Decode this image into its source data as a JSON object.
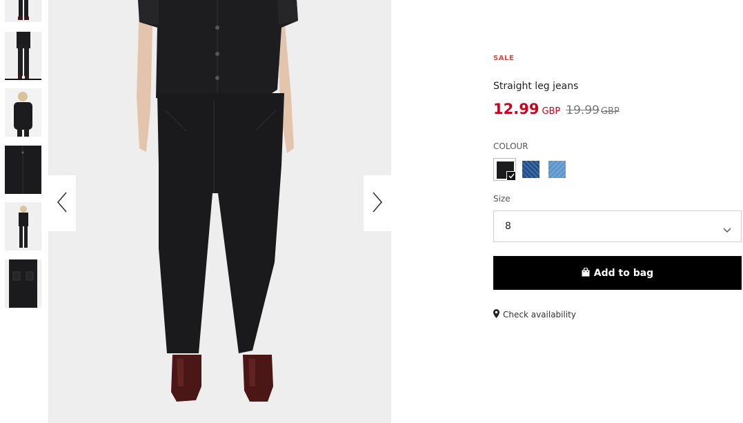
{
  "gallery": {
    "thumbnails": [
      {
        "name": "thumb-1",
        "alt": "full look legs"
      },
      {
        "name": "thumb-2",
        "alt": "full look front",
        "active": true
      },
      {
        "name": "thumb-3",
        "alt": "upper body"
      },
      {
        "name": "thumb-4",
        "alt": "jeans detail"
      },
      {
        "name": "thumb-5",
        "alt": "full look side"
      },
      {
        "name": "thumb-6",
        "alt": "back detail"
      }
    ],
    "prev_icon": "chevron-left-icon",
    "next_icon": "chevron-right-icon"
  },
  "product": {
    "badge": "SALE",
    "title": "Straight leg jeans",
    "price_now": "12.99",
    "price_now_currency": "GBP",
    "price_was": "19.99",
    "price_was_currency": "GBP"
  },
  "colour": {
    "label": "COLOUR",
    "options": [
      {
        "name": "black",
        "color": "#1b1b1d",
        "selected": true
      },
      {
        "name": "dark-blue",
        "color": "#1f4e8c",
        "selected": false
      },
      {
        "name": "light-blue",
        "color": "#5b96cc",
        "selected": false
      }
    ]
  },
  "size": {
    "label": "Size",
    "selected": "8",
    "icon": "chevron-down-icon"
  },
  "cart": {
    "add_label": "Add to bag",
    "icon": "bag-icon"
  },
  "availability": {
    "label": "Check availability",
    "icon": "location-pin-icon"
  },
  "colors": {
    "sale_red": "#d0021b",
    "badge_red": "#e4463c",
    "button_black": "#000000"
  }
}
